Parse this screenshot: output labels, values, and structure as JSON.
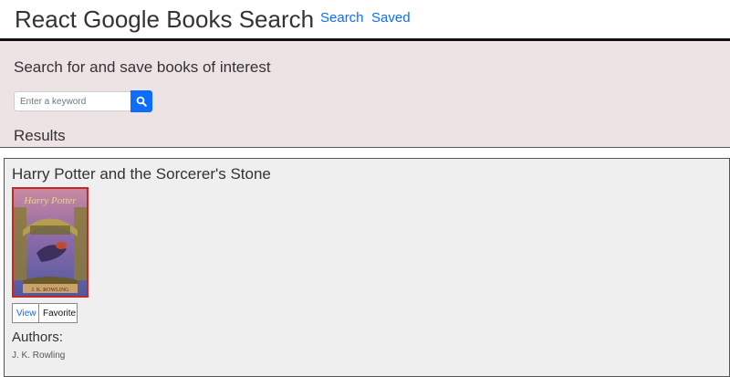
{
  "header": {
    "brand": "React Google Books Search",
    "nav": {
      "search": "Search",
      "saved": "Saved"
    }
  },
  "search": {
    "heading": "Search for and save books of interest",
    "input_value": "",
    "placeholder": "Enter a keyword",
    "button_icon": "search-icon"
  },
  "results": {
    "heading": "Results",
    "items": [
      {
        "title": "Harry Potter and the Sorcerer's Stone",
        "cover_title_art": "Harry Potter",
        "cover_author_art": "J. K. ROWLING",
        "view_label": "View",
        "favorite_label": "Favorite",
        "authors_heading": "Authors:",
        "authors": "J. K. Rowling"
      }
    ]
  },
  "colors": {
    "link": "#0d6efd",
    "search_panel_bg": "#ede3e4",
    "card_bg": "#efefef",
    "cover_border": "#c62828"
  }
}
